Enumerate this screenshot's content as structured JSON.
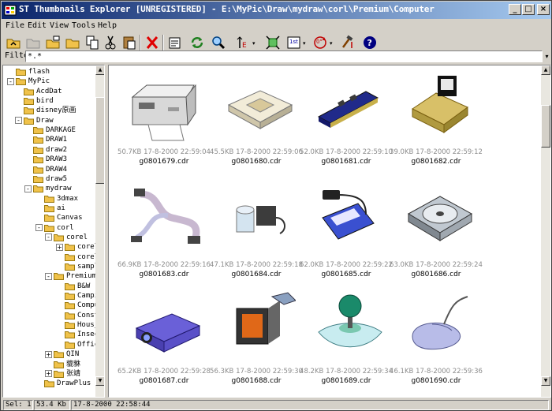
{
  "window": {
    "title": "ST Thumbnails Explorer [UNREGISTERED] - E:\\MyPic\\Draw\\mydraw\\corl\\Premium\\Computer",
    "minimize": "_",
    "maximize": "□",
    "close": "×"
  },
  "menu": [
    "File",
    "Edit",
    "View",
    "Tools",
    "Help"
  ],
  "toolbar": {
    "buttons": [
      "up-folder-icon",
      "disabled-folder-icon",
      "new-folder-icon",
      "folder-icon",
      "copy-icon",
      "cut-icon",
      "paste-icon",
      "delete-icon",
      "properties-icon",
      "refresh-icon",
      "zoom-icon",
      "sort-icon",
      "fit-icon",
      "first-icon",
      "rotate-icon",
      "tools-icon",
      "help-icon"
    ],
    "dropdown": "▾",
    "rotate_label": "0°",
    "first_label": "1st"
  },
  "filter": {
    "label": "Filter:",
    "value": "*.*",
    "dropdown": "▾"
  },
  "tree": [
    {
      "label": "flash",
      "depth": 0,
      "expander": ""
    },
    {
      "label": "MyPic",
      "depth": 0,
      "expander": "-"
    },
    {
      "label": "AcdDat",
      "depth": 1,
      "expander": ""
    },
    {
      "label": "bird",
      "depth": 1,
      "expander": ""
    },
    {
      "label": "disney原画",
      "depth": 1,
      "expander": ""
    },
    {
      "label": "Draw",
      "depth": 1,
      "expander": "-"
    },
    {
      "label": "DARKAGE",
      "depth": 2,
      "expander": ""
    },
    {
      "label": "DRAW1",
      "depth": 2,
      "expander": ""
    },
    {
      "label": "draw2",
      "depth": 2,
      "expander": ""
    },
    {
      "label": "DRAW3",
      "depth": 2,
      "expander": ""
    },
    {
      "label": "DRAW4",
      "depth": 2,
      "expander": ""
    },
    {
      "label": "draw5",
      "depth": 2,
      "expander": ""
    },
    {
      "label": "mydraw",
      "depth": 2,
      "expander": "-"
    },
    {
      "label": "3dmax",
      "depth": 3,
      "expander": ""
    },
    {
      "label": "ai",
      "depth": 3,
      "expander": ""
    },
    {
      "label": "Canvas",
      "depth": 3,
      "expander": ""
    },
    {
      "label": "corl",
      "depth": 3,
      "expander": "-"
    },
    {
      "label": "corel",
      "depth": 4,
      "expander": "-"
    },
    {
      "label": "corels",
      "depth": 5,
      "expander": "+"
    },
    {
      "label": "corels",
      "depth": 5,
      "expander": ""
    },
    {
      "label": "sample",
      "depth": 5,
      "expander": ""
    },
    {
      "label": "Premium",
      "depth": 4,
      "expander": "-"
    },
    {
      "label": "B&W",
      "depth": 5,
      "expander": ""
    },
    {
      "label": "Campir",
      "depth": 5,
      "expander": ""
    },
    {
      "label": "Comput",
      "depth": 5,
      "expander": ""
    },
    {
      "label": "Constr",
      "depth": 5,
      "expander": ""
    },
    {
      "label": "Hous_c",
      "depth": 5,
      "expander": ""
    },
    {
      "label": "Insect",
      "depth": 5,
      "expander": ""
    },
    {
      "label": "Office_",
      "depth": 5,
      "expander": ""
    },
    {
      "label": "QIN",
      "depth": 4,
      "expander": "+"
    },
    {
      "label": "貔貅",
      "depth": 4,
      "expander": ""
    },
    {
      "label": "张靖",
      "depth": 4,
      "expander": "+"
    },
    {
      "label": "DrawPlus",
      "depth": 3,
      "expander": ""
    }
  ],
  "thumbnails": [
    {
      "size": "50.7KB",
      "date": "17-8-2000 22:59:04",
      "name": "g0801679.cdr",
      "icon": "printer-icon"
    },
    {
      "size": "45.5KB",
      "date": "17-8-2000 22:59:06",
      "name": "g0801680.cdr",
      "icon": "cpu-socket-icon"
    },
    {
      "size": "52.0KB",
      "date": "17-8-2000 22:59:10",
      "name": "g0801681.cdr",
      "icon": "memory-module-icon"
    },
    {
      "size": "39.0KB",
      "date": "17-8-2000 22:59:12",
      "name": "g0801682.cdr",
      "icon": "cpu-chip-icon"
    },
    {
      "size": "66.9KB",
      "date": "17-8-2000 22:59:16",
      "name": "g0801683.cdr",
      "icon": "ribbon-cable-icon"
    },
    {
      "size": "47.1KB",
      "date": "17-8-2000 22:59:18",
      "name": "g0801684.cdr",
      "icon": "power-adapter-icon"
    },
    {
      "size": "62.0KB",
      "date": "17-8-2000 22:59:22",
      "name": "g0801685.cdr",
      "icon": "pc-card-icon"
    },
    {
      "size": "63.0KB",
      "date": "17-8-2000 22:59:24",
      "name": "g0801686.cdr",
      "icon": "hard-disk-icon"
    },
    {
      "size": "65.2KB",
      "date": "17-8-2000 22:59:28",
      "name": "g0801687.cdr",
      "icon": "projector-icon"
    },
    {
      "size": "56.3KB",
      "date": "17-8-2000 22:59:30",
      "name": "g0801688.cdr",
      "icon": "monitor-icon"
    },
    {
      "size": "48.2KB",
      "date": "17-8-2000 22:59:34",
      "name": "g0801689.cdr",
      "icon": "joystick-icon"
    },
    {
      "size": "46.1KB",
      "date": "17-8-2000 22:59:36",
      "name": "g0801690.cdr",
      "icon": "mouse-icon"
    }
  ],
  "status": {
    "sel": "Sel: 1",
    "size": "53.4 Kb",
    "date": "17-8-2000  22:58:44"
  },
  "scroll": {
    "tree_up": "▲",
    "tree_down": "▼",
    "content_up": "▲",
    "content_down": "▼"
  }
}
